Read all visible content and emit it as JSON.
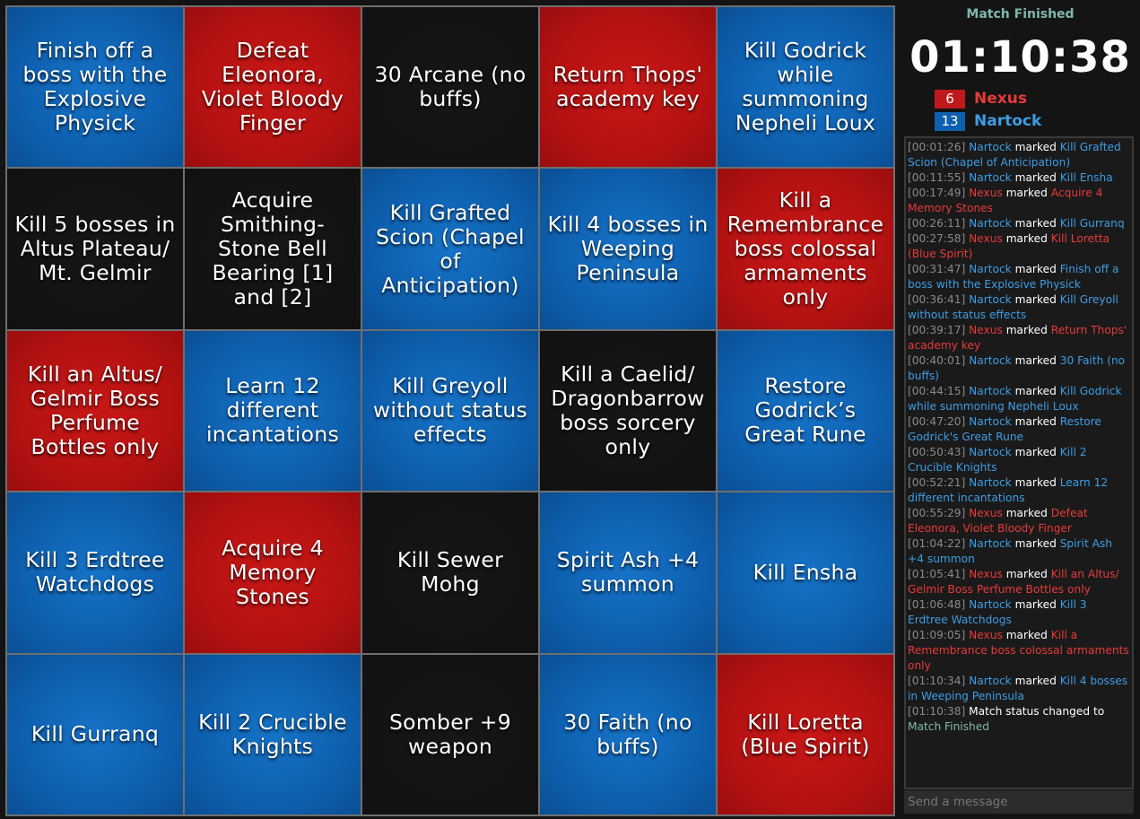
{
  "board": [
    {
      "label": "Finish off a boss with the Explosive Physick",
      "owner": "blue"
    },
    {
      "label": "Defeat Eleonora, Violet Bloody Finger",
      "owner": "red"
    },
    {
      "label": "30 Arcane (no buffs)",
      "owner": "none"
    },
    {
      "label": "Return Thops' academy key",
      "owner": "red"
    },
    {
      "label": "Kill Godrick while summoning Nepheli Loux",
      "owner": "blue"
    },
    {
      "label": "Kill 5 bosses in Altus Plateau/ Mt. Gelmir",
      "owner": "none"
    },
    {
      "label": "Acquire Smithing-Stone Bell Bearing [1] and [2]",
      "owner": "none"
    },
    {
      "label": "Kill Grafted Scion (Chapel of Anticipation)",
      "owner": "blue"
    },
    {
      "label": "Kill 4 bosses in Weeping Peninsula",
      "owner": "blue"
    },
    {
      "label": "Kill a Remembrance boss colossal armaments only",
      "owner": "red"
    },
    {
      "label": "Kill an Altus/ Gelmir Boss Perfume Bottles only",
      "owner": "red"
    },
    {
      "label": "Learn 12 different incantations",
      "owner": "blue"
    },
    {
      "label": "Kill Greyoll without status effects",
      "owner": "blue"
    },
    {
      "label": "Kill a Caelid/ Dragonbarrow boss sorcery only",
      "owner": "none"
    },
    {
      "label": "Restore Godrick’s Great Rune",
      "owner": "blue"
    },
    {
      "label": "Kill 3 Erdtree Watchdogs",
      "owner": "blue"
    },
    {
      "label": "Acquire 4 Memory Stones",
      "owner": "red"
    },
    {
      "label": "Kill Sewer Mohg",
      "owner": "none"
    },
    {
      "label": "Spirit Ash +4 summon",
      "owner": "blue"
    },
    {
      "label": "Kill Ensha",
      "owner": "blue"
    },
    {
      "label": "Kill Gurranq",
      "owner": "blue"
    },
    {
      "label": "Kill 2 Crucible Knights",
      "owner": "blue"
    },
    {
      "label": "Somber +9 weapon",
      "owner": "none"
    },
    {
      "label": "30 Faith (no buffs)",
      "owner": "blue"
    },
    {
      "label": "Kill Loretta (Blue Spirit)",
      "owner": "red"
    }
  ],
  "sidebar": {
    "status": "Match Finished",
    "timer": "01:10:38",
    "players": [
      {
        "score": "6",
        "name": "Nexus",
        "color": "#e83a3a",
        "box": "#c0191b"
      },
      {
        "score": "13",
        "name": "Nartock",
        "color": "#3d9de4",
        "box": "#0e5fae"
      }
    ],
    "log": [
      {
        "time": "[00:01:26]",
        "who": "Nartock",
        "team": "blue",
        "verb": "marked",
        "what": "Kill Grafted Scion (Chapel of Anticipation)"
      },
      {
        "time": "[00:11:55]",
        "who": "Nartock",
        "team": "blue",
        "verb": "marked",
        "what": "Kill Ensha"
      },
      {
        "time": "[00:17:49]",
        "who": "Nexus",
        "team": "red",
        "verb": "marked",
        "what": "Acquire 4 Memory Stones"
      },
      {
        "time": "[00:26:11]",
        "who": "Nartock",
        "team": "blue",
        "verb": "marked",
        "what": "Kill Gurranq"
      },
      {
        "time": "[00:27:58]",
        "who": "Nexus",
        "team": "red",
        "verb": "marked",
        "what": "Kill Loretta (Blue Spirit)"
      },
      {
        "time": "[00:31:47]",
        "who": "Nartock",
        "team": "blue",
        "verb": "marked",
        "what": "Finish off a boss with the Explosive Physick"
      },
      {
        "time": "[00:36:41]",
        "who": "Nartock",
        "team": "blue",
        "verb": "marked",
        "what": "Kill Greyoll without status effects"
      },
      {
        "time": "[00:39:17]",
        "who": "Nexus",
        "team": "red",
        "verb": "marked",
        "what": "Return Thops' academy key"
      },
      {
        "time": "[00:40:01]",
        "who": "Nartock",
        "team": "blue",
        "verb": "marked",
        "what": "30 Faith (no buffs)"
      },
      {
        "time": "[00:44:15]",
        "who": "Nartock",
        "team": "blue",
        "verb": "marked",
        "what": "Kill Godrick while summoning Nepheli Loux"
      },
      {
        "time": "[00:47:20]",
        "who": "Nartock",
        "team": "blue",
        "verb": "marked",
        "what": "Restore Godrick's Great Rune"
      },
      {
        "time": "[00:50:43]",
        "who": "Nartock",
        "team": "blue",
        "verb": "marked",
        "what": "Kill 2 Crucible Knights"
      },
      {
        "time": "[00:52:21]",
        "who": "Nartock",
        "team": "blue",
        "verb": "marked",
        "what": "Learn 12 different incantations"
      },
      {
        "time": "[00:55:29]",
        "who": "Nexus",
        "team": "red",
        "verb": "marked",
        "what": "Defeat Eleonora, Violet Bloody Finger"
      },
      {
        "time": "[01:04:22]",
        "who": "Nartock",
        "team": "blue",
        "verb": "marked",
        "what": "Spirit Ash +4 summon"
      },
      {
        "time": "[01:05:41]",
        "who": "Nexus",
        "team": "red",
        "verb": "marked",
        "what": "Kill an Altus/ Gelmir Boss Perfume Bottles only"
      },
      {
        "time": "[01:06:48]",
        "who": "Nartock",
        "team": "blue",
        "verb": "marked",
        "what": "Kill 3 Erdtree Watchdogs"
      },
      {
        "time": "[01:09:05]",
        "who": "Nexus",
        "team": "red",
        "verb": "marked",
        "what": "Kill a Remembrance boss colossal armaments only"
      },
      {
        "time": "[01:10:34]",
        "who": "Nartock",
        "team": "blue",
        "verb": "marked",
        "what": "Kill 4 bosses in Weeping Peninsula"
      },
      {
        "time": "[01:10:38]",
        "who": "",
        "team": "",
        "verb": "Match status changed to",
        "what": "Match Finished",
        "whatTeam": "teal"
      }
    ],
    "message_placeholder": "Send a message"
  }
}
